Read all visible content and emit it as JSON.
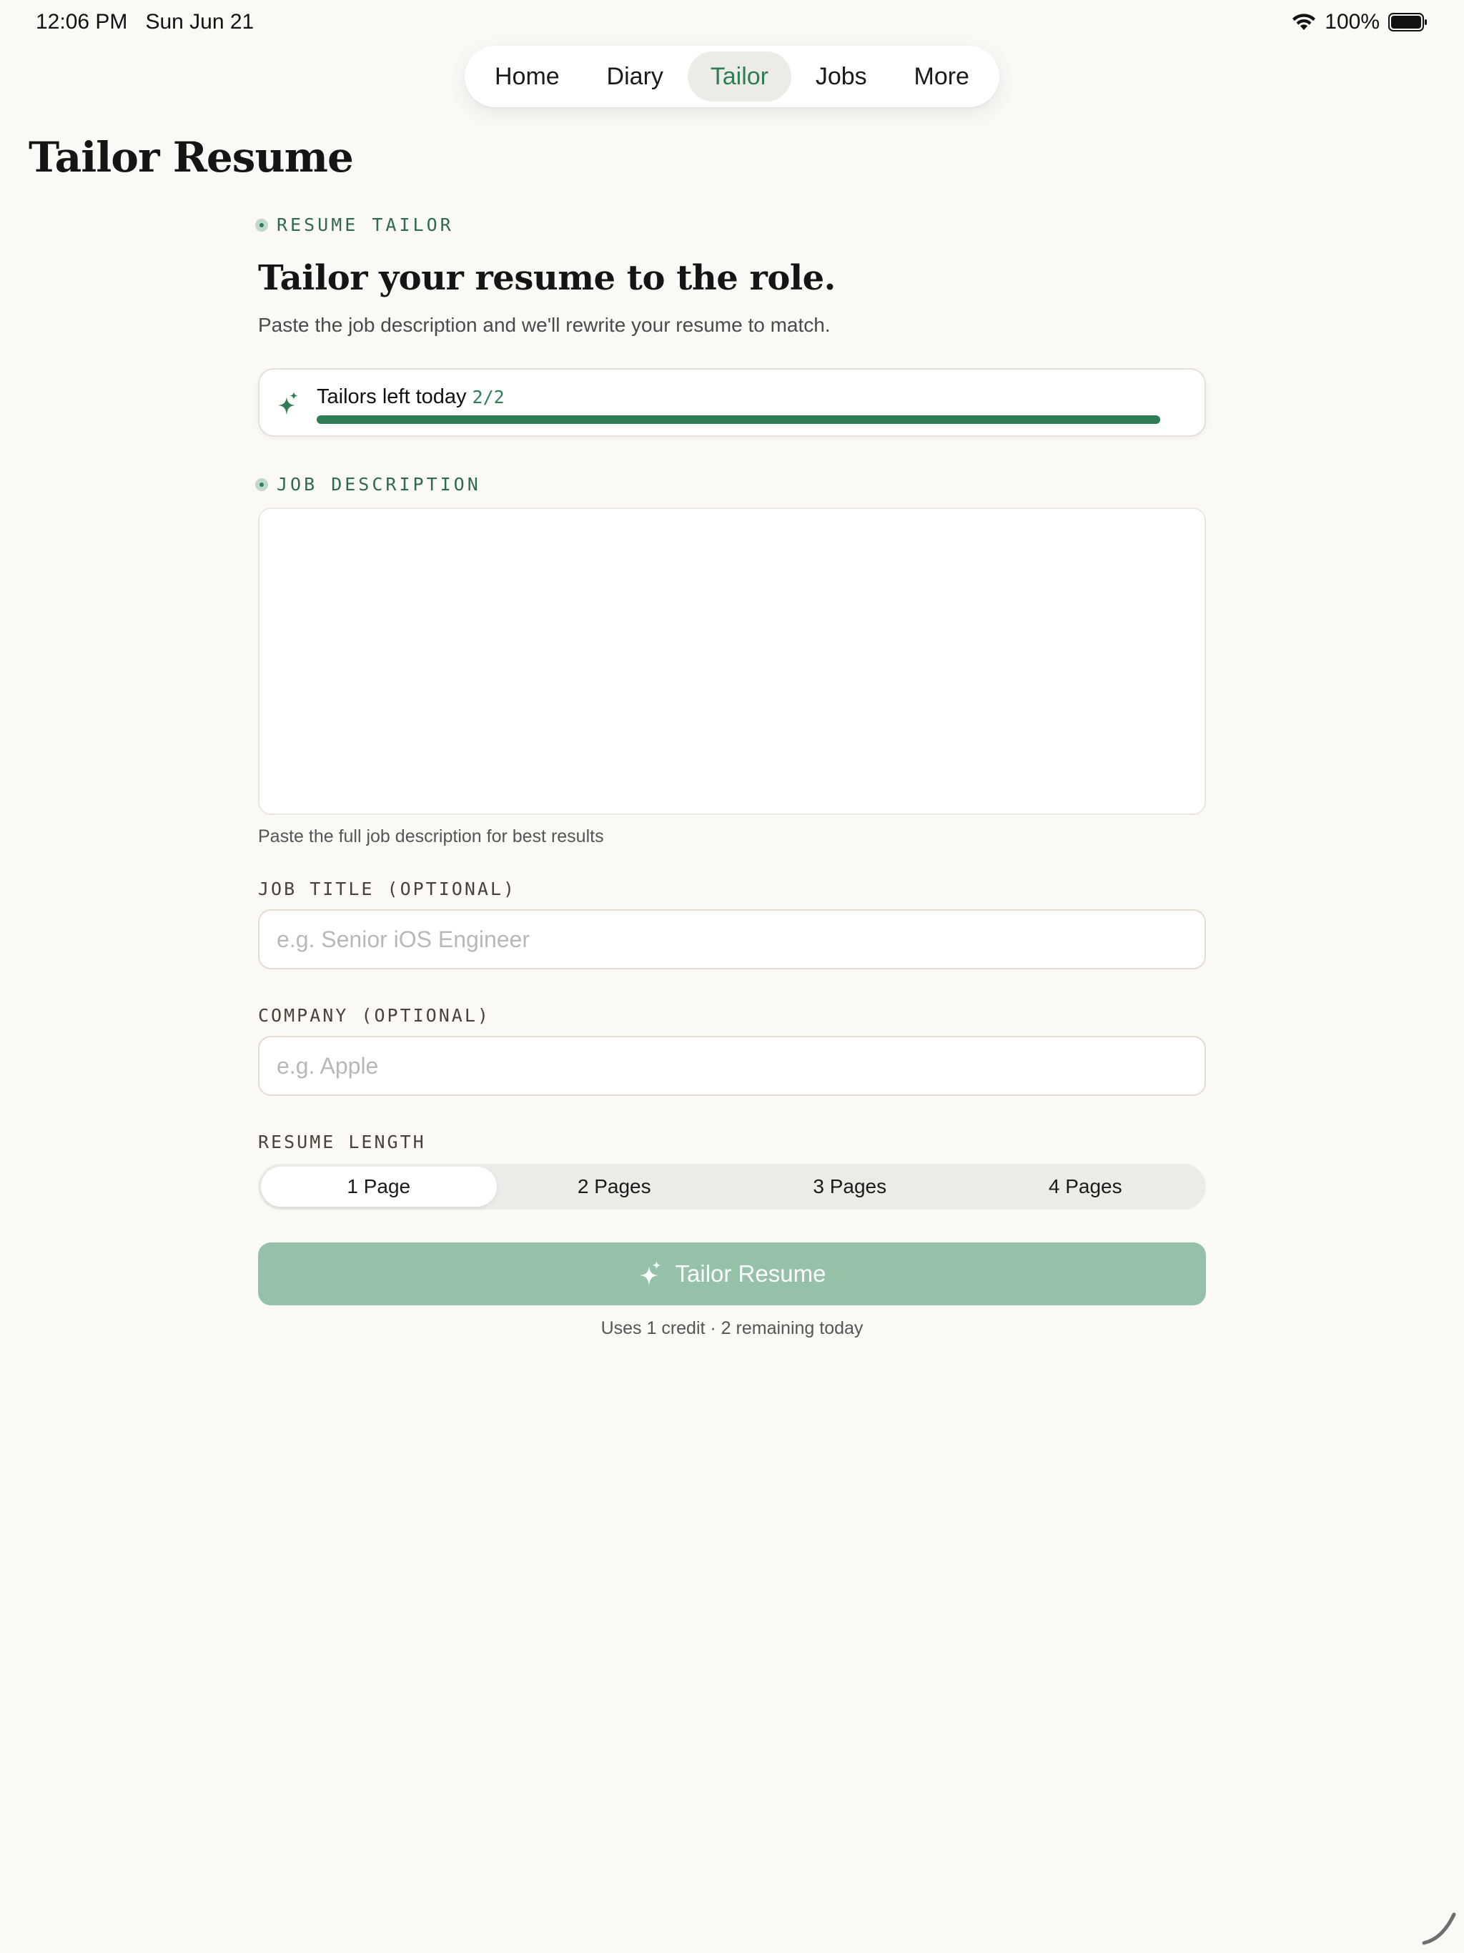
{
  "status_bar": {
    "time": "12:06 PM",
    "date": "Sun Jun 21",
    "battery": "100%"
  },
  "nav": {
    "tabs": [
      {
        "label": "Home",
        "active": false
      },
      {
        "label": "Diary",
        "active": false
      },
      {
        "label": "Tailor",
        "active": true
      },
      {
        "label": "Jobs",
        "active": false
      },
      {
        "label": "More",
        "active": false
      }
    ]
  },
  "page": {
    "title": "Tailor Resume"
  },
  "hero": {
    "eyebrow": "RESUME TAILOR",
    "headline": "Tailor your resume to the role.",
    "subhead": "Paste the job description and we'll rewrite your resume to match."
  },
  "credits": {
    "label": "Tailors left today",
    "count": "2/2",
    "progress": 1.0
  },
  "job_description": {
    "eyebrow": "JOB DESCRIPTION",
    "value": "",
    "hint": "Paste the full job description for best results"
  },
  "job_title": {
    "label": "JOB TITLE (OPTIONAL)",
    "placeholder": "e.g. Senior iOS Engineer",
    "value": ""
  },
  "company": {
    "label": "COMPANY (OPTIONAL)",
    "placeholder": "e.g. Apple",
    "value": ""
  },
  "resume_length": {
    "label": "RESUME LENGTH",
    "options": [
      "1 Page",
      "2 Pages",
      "3 Pages",
      "4 Pages"
    ],
    "selected": "1 Page"
  },
  "cta": {
    "label": "Tailor Resume",
    "note": "Uses 1 credit · 2 remaining today"
  },
  "colors": {
    "accent": "#2e7d55",
    "button_disabled": "#94c1a8",
    "background": "#faf9f6"
  }
}
